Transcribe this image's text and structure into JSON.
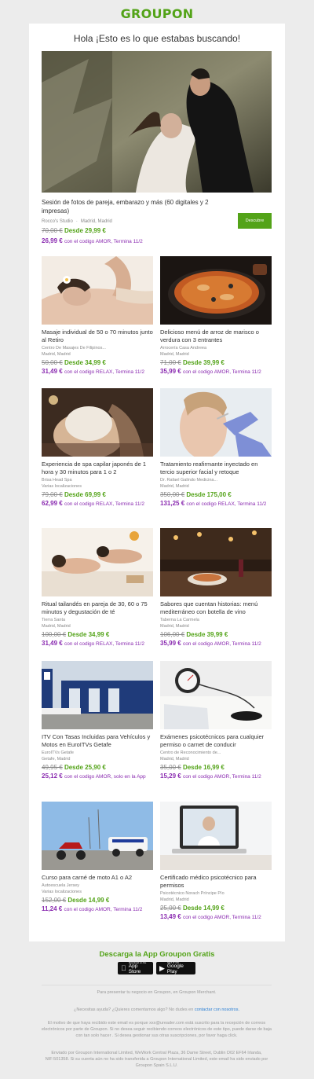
{
  "brand": "GROUPON",
  "headline": "Hola ¡Esto es lo que estabas buscando!",
  "hero": {
    "title": "Sesión de fotos de pareja, embarazo y más (60 digitales y 2 impresas)",
    "merchant": "Rocco's Studio",
    "location": "Madrid, Madrid",
    "old_price": "70,00 €",
    "price": "Desde 29,99 €",
    "promo_price": "26,99 €",
    "promo_text": "con el codigo AMOR, Termina 11/2",
    "button": "Descubre"
  },
  "deals": [
    {
      "title": "Masaje individual de 50 o 70 minutos junto al Retiro",
      "merchant": "Centro De Masajes De Filipinos...",
      "location": "Madrid, Madrid",
      "old_price": "50,00 €",
      "price": "Desde 34,99 €",
      "promo_price": "31,49 €",
      "promo_text": "con el codigo RELAX, Termina 11/2",
      "image": "massage"
    },
    {
      "title": "Delicioso menú de arroz de marisco o verdura con 3 entrantes",
      "merchant": "Arrocería Casa Andreea",
      "location": "Madrid, Madrid",
      "old_price": "71,00 €",
      "price": "Desde 39,99 €",
      "promo_price": "35,99 €",
      "promo_text": "con el codigo AMOR, Termina 11/2",
      "image": "paella"
    },
    {
      "title": "Experiencia de spa capilar japonés de 1 hora y 30 minutos para 1 o 2",
      "merchant": "Brisa Head Spa",
      "location": "Varias localizaciones",
      "old_price": "79,00 €",
      "price": "Desde 69,99 €",
      "promo_price": "62,99 €",
      "promo_text": "con el codigo RELAX, Termina 11/2",
      "image": "headspa"
    },
    {
      "title": "Tratamiento reafirmante inyectado en tercio superior facial y retoque",
      "merchant": "Dr. Rafael Galindo Medicina...",
      "location": "Madrid, Madrid",
      "old_price": "350,00 €",
      "price": "Desde 175,00 €",
      "promo_price": "131,25 €",
      "promo_text": "con el codigo RELAX, Termina 11/2",
      "image": "injection"
    },
    {
      "title": "Ritual tailandés en pareja de 30, 60 o 75 minutos y degustación de té",
      "merchant": "Tierra Santa",
      "location": "Madrid, Madrid",
      "old_price": "100,00 €",
      "price": "Desde 34,99 €",
      "promo_price": "31,49 €",
      "promo_text": "con el codigo RELAX, Termina 11/2",
      "image": "couple-massage"
    },
    {
      "title": "Sabores que cuentan historias: menú mediterráneo con botella de vino",
      "merchant": "Taberna La Carmela",
      "location": "Madrid, Madrid",
      "old_price": "106,00 €",
      "price": "Desde 39,99 €",
      "promo_price": "35,99 €",
      "promo_text": "con el codigo AMOR, Termina 11/2",
      "image": "restaurant"
    },
    {
      "title": "ITV Con Tasas Incluidas para Vehículos y Motos en EuroITVs Getafe",
      "merchant": "EuroITVs Getafe",
      "location": "Getafe, Madrid",
      "old_price": "49,95 €",
      "price": "Desde 25,90 €",
      "promo_price": "25,12 €",
      "promo_text": "con el codigo AMOR, solo en la App",
      "image": "itv"
    },
    {
      "title": "Exámenes psicotécnicos para cualquier permiso o carnet de conducir",
      "merchant": "Centro de Reconocimiento de...",
      "location": "Madrid, Madrid",
      "old_price": "35,00 €",
      "price": "Desde 16,99 €",
      "promo_price": "15,29 €",
      "promo_text": "con el codigo AMOR, Termina 11/2",
      "image": "blood-pressure"
    },
    {
      "title": "Curso para carné de moto A1 o A2",
      "merchant": "Autoescuela Jersey",
      "location": "Varias localizaciones",
      "old_price": "152,00 €",
      "price": "Desde 14,99 €",
      "promo_price": "11,24 €",
      "promo_text": "con el codigo AMOR, Termina 11/2",
      "image": "motorbikes"
    },
    {
      "title": "Certificado médico psicotécnico para permisos",
      "merchant": "Psicotécnico Norach Príncipe Pío",
      "location": "Madrid, Madrid",
      "old_price": "25,00 €",
      "price": "Desde 14,99 €",
      "promo_price": "13,49 €",
      "promo_text": "con el codigo AMOR, Termina 11/2",
      "image": "telemedicine"
    }
  ],
  "app": {
    "title": "Descarga la App Groupon Gratis",
    "appstore_small": "Download on the",
    "appstore_big": "App Store",
    "googleplay_small": "GET IT ON",
    "googleplay_big": "Google Play"
  },
  "footer": {
    "merchant_line": "Para presentar tu negocio en Groupon, en Groupon Merchant.",
    "help_prefix": "¿Necesitas ayuda? ¿Quieres comentarnos algo? No dudes en",
    "help_link": "contactar con nosotros.",
    "reason": "El motivo de que haya recibido este email es porque xxx@ureader.com está suscrito para la recepción de correos electrónicos por parte de Groupon. Si no desea seguir recibiendo correos electrónicos de este tipo, puede darse de baja con tan solo hacer . Si desea gestionar sus otras suscripciones, por favor haga click.",
    "sender": "Enviado por Groupon International Limited, WeWork Central Plaza, 36 Dame Street, Dublin D02 EF64 Irlanda, NIF:501358. Si su cuenta aún no ha sido transferida a Groupon International Limited, este email ha sido enviado por Groupon Spain S.L.U."
  },
  "colors": {
    "brand_green": "#53a318",
    "promo_purple": "#8a2bb0",
    "link_blue": "#2a7fd4"
  }
}
